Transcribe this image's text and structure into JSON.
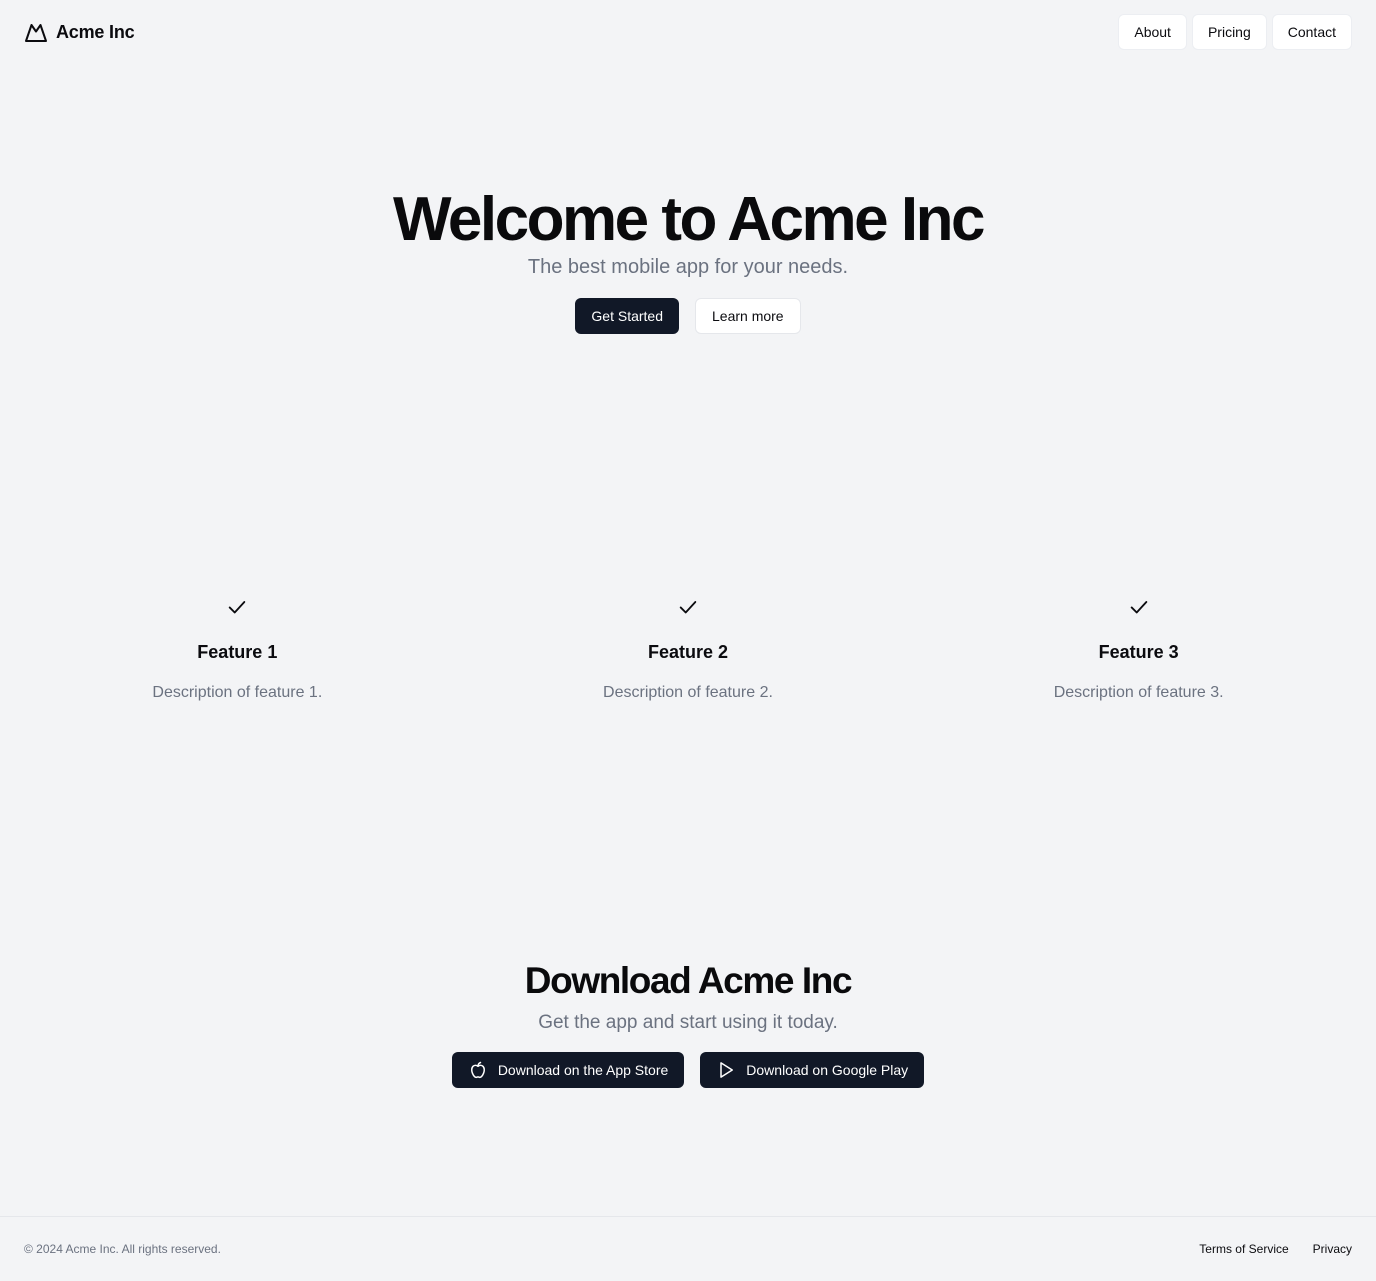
{
  "header": {
    "brand": "Acme Inc",
    "nav": [
      {
        "label": "About"
      },
      {
        "label": "Pricing"
      },
      {
        "label": "Contact"
      }
    ]
  },
  "hero": {
    "title": "Welcome to Acme Inc",
    "subtitle": "The best mobile app for your needs.",
    "primary_button": "Get Started",
    "secondary_button": "Learn more"
  },
  "features": [
    {
      "icon": "check-icon",
      "title": "Feature 1",
      "description": "Description of feature 1."
    },
    {
      "icon": "check-icon",
      "title": "Feature 2",
      "description": "Description of feature 2."
    },
    {
      "icon": "check-icon",
      "title": "Feature 3",
      "description": "Description of feature 3."
    }
  ],
  "download": {
    "title": "Download Acme Inc",
    "subtitle": "Get the app and start using it today.",
    "app_store_button": {
      "icon": "apple-icon",
      "label": "Download on the App Store"
    },
    "google_play_button": {
      "icon": "play-icon",
      "label": "Download on Google Play"
    }
  },
  "footer": {
    "copyright": "© 2024 Acme Inc. All rights reserved.",
    "links": [
      {
        "label": "Terms of Service"
      },
      {
        "label": "Privacy"
      }
    ]
  },
  "colors": {
    "background": "#f3f4f6",
    "primary_button": "#111827",
    "muted_text": "#6b7280",
    "text": "#0b0b0f"
  }
}
